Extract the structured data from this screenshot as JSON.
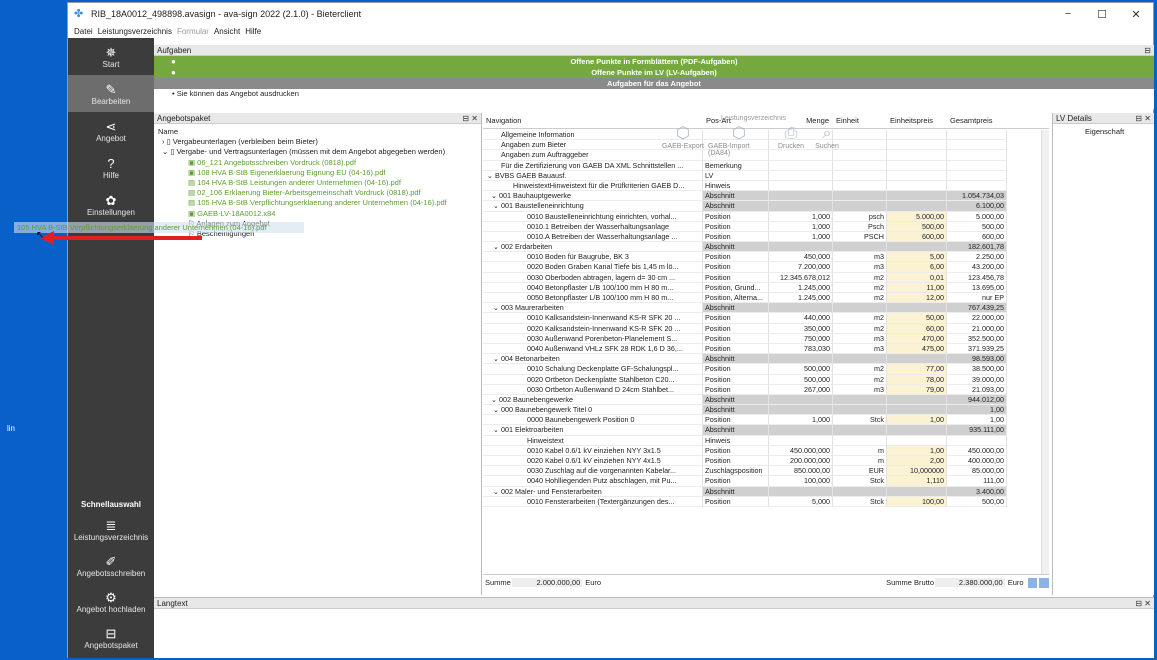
{
  "desktop": {
    "icon_label": "lin"
  },
  "window": {
    "title": "RIB_18A0012_498898.avasign - ava-sign 2022 (2.1.0) - Bieterclient",
    "controls": {
      "minimize": "−",
      "maximize": "☐",
      "close": "✕"
    }
  },
  "menu": {
    "items": [
      "Datei",
      "Leistungsverzeichnis",
      "Formular",
      "Ansicht",
      "Hilfe"
    ]
  },
  "sidebar": {
    "top": [
      {
        "label": "Start",
        "icon": "snowflake-icon",
        "glyph": "✵"
      },
      {
        "label": "Bearbeiten",
        "icon": "pencil-icon",
        "glyph": "✎"
      },
      {
        "label": "Angebot",
        "icon": "share-icon",
        "glyph": "⋖"
      },
      {
        "label": "Hilfe",
        "icon": "help-icon",
        "glyph": "?"
      },
      {
        "label": "Einstellungen",
        "icon": "gear-icon",
        "glyph": "✿"
      }
    ],
    "quick_header": "Schnellauswahl",
    "bottom": [
      {
        "label": "Leistungsverzeichnis",
        "icon": "coins-icon",
        "glyph": "≣"
      },
      {
        "label": "Angebotsschreiben",
        "icon": "edit-doc-icon",
        "glyph": "✐"
      },
      {
        "label": "Angebot hochladen",
        "icon": "upload-icon",
        "glyph": "⚙"
      },
      {
        "label": "Angebotspaket",
        "icon": "package-icon",
        "glyph": "⊟"
      }
    ]
  },
  "aufgaben": {
    "title": "Aufgaben",
    "bars": [
      "Offene Punkte in Formblättern (PDF-Aufgaben)",
      "Offene Punkte im LV (LV-Aufgaben)",
      "Aufgaben für das Angebot"
    ],
    "info": "Sie können das Angebot ausdrucken"
  },
  "angebotspaket": {
    "title": "Angebotspaket",
    "header": "Name",
    "items": [
      "Vergabeunterlagen (verbleiben beim Bieter)",
      "Vergabe- und Vertragsunterlagen (müssen mit dem Angebot abgegeben werden)",
      "06_121 Angebotsschreiben Vordruck (0818).pdf",
      "108 HVA B-StB Eigenerklaerung Eignung EU (04-16).pdf",
      "104 HVA B-StB Leistungen anderer Unternehmen (04-16).pdf",
      "02_106 Erklaerung Bieter-Arbeitsgemeinschaft Vordruck (0818).pdf",
      "105 HVA B-StB Verpflichtungserklaerung anderer Unternehmen (04-16).pdf",
      "GAEB-LV-18A0012.x84",
      "Anlagen zum Angebot",
      "Bescheinigungen"
    ],
    "drag_text": "105 HVA B-StB Verpflichtungserklaerung anderer Unternehmen (04-16).pdf"
  },
  "navigation": {
    "title": "Navigation",
    "columns": [
      "Pos-Art",
      "Menge",
      "Einheit",
      "Einheitspreis",
      "Gesamtpreis"
    ],
    "toolbar_group": "Leistungsverzeichnis",
    "toolbar": [
      "GAEB-Export",
      "GAEB-Import (DA84)",
      "Drucken",
      "Suchen"
    ],
    "rows": [
      [
        "Allgemeine Information",
        "",
        "",
        "",
        "",
        ""
      ],
      [
        "Angaben zum Bieter",
        "",
        "",
        "",
        "",
        ""
      ],
      [
        "Angaben zum Auftraggeber",
        "",
        "",
        "",
        "",
        ""
      ],
      [
        "Für die Zertifizierung von GAEB DA XML Schnittstellen ...",
        "Bemerkung",
        "",
        "",
        "",
        ""
      ],
      [
        "BVBS GAEB Bauausf.",
        "LV",
        "",
        "",
        "",
        ""
      ],
      [
        "HinweistextHinweistext für die Prüfkriterien GAEB D...",
        "Hinweis",
        "",
        "",
        "",
        ""
      ],
      [
        "001 Bauhauptgewerke",
        "Abschnitt",
        "",
        "",
        "",
        "1.054.734,03"
      ],
      [
        "001 Baustelleneinrichtung",
        "Abschnitt",
        "",
        "",
        "",
        "6.100,00"
      ],
      [
        "0010 Baustelleneinrichtung einrichten, vorhal...",
        "Position",
        "1,000",
        "psch",
        "5.000,00",
        "5.000,00"
      ],
      [
        "0010.1 Betreiben der Wasserhaltungsanlage",
        "Position",
        "1,000",
        "Psch",
        "500,00",
        "500,00"
      ],
      [
        "0010.A Betreiben der Wasserhaltungsanlage ...",
        "Position",
        "1,000",
        "PSCH",
        "600,00",
        "600,00"
      ],
      [
        "002 Erdarbeiten",
        "Abschnitt",
        "",
        "",
        "",
        "182.601,78"
      ],
      [
        "0010 Boden für Baugrube, BK 3",
        "Position",
        "450,000",
        "m3",
        "5,00",
        "2.250,00"
      ],
      [
        "0020 Boden Graben Kanal Tiefe bis 1,45 m lö...",
        "Position",
        "7.200,000",
        "m3",
        "6,00",
        "43.200,00"
      ],
      [
        "0030 Oberboden abtragen, lagern d= 30 cm ...",
        "Position",
        "12.345.678,012",
        "m2",
        "0,01",
        "123.456,78"
      ],
      [
        "0040 Betonpflaster L/B 100/100 mm H 80 m...",
        "Position, Grund...",
        "1.245,000",
        "m2",
        "11,00",
        "13.695,00"
      ],
      [
        "0050 Betonpflaster L/B 100/100 mm H 80 m...",
        "Position, Alterna...",
        "1.245,000",
        "m2",
        "12,00",
        "nur EP"
      ],
      [
        "003 Maurerarbeiten",
        "Abschnitt",
        "",
        "",
        "",
        "767.439,25"
      ],
      [
        "0010 Kalksandstein-Innenwand KS-R SFK 20 ...",
        "Position",
        "440,000",
        "m2",
        "50,00",
        "22.000,00"
      ],
      [
        "0020 Kalksandstein-Innenwand KS-R SFK 20 ...",
        "Position",
        "350,000",
        "m2",
        "60,00",
        "21.000,00"
      ],
      [
        "0030 Außenwand Porenbeton-Planelement S...",
        "Position",
        "750,000",
        "m3",
        "470,00",
        "352.500,00"
      ],
      [
        "0040 Außenwand VHLz SFK 28 RDK 1,6 D 36,...",
        "Position",
        "783,030",
        "m3",
        "475,00",
        "371.939,25"
      ],
      [
        "004 Betonarbeiten",
        "Abschnitt",
        "",
        "",
        "",
        "98.593,00"
      ],
      [
        "0010 Schalung Deckenplatte GF-Schalungspl...",
        "Position",
        "500,000",
        "m2",
        "77,00",
        "38.500,00"
      ],
      [
        "0020 Ortbeton Deckenplatte Stahlbeton C20...",
        "Position",
        "500,000",
        "m2",
        "78,00",
        "39.000,00"
      ],
      [
        "0030 Ortbeton Außenwand D 24cm Stahlbet...",
        "Position",
        "267,000",
        "m3",
        "79,00",
        "21.093,00"
      ],
      [
        "002 Baunebengewerke",
        "Abschnitt",
        "",
        "",
        "",
        "944.012,00"
      ],
      [
        "000 Baunebengewerk Titel 0",
        "Abschnitt",
        "",
        "",
        "",
        "1,00"
      ],
      [
        "0000 Baunebengewerk Position 0",
        "Position",
        "1,000",
        "Stck",
        "1,00",
        "1,00"
      ],
      [
        "001 Elektroarbeiten",
        "Abschnitt",
        "",
        "",
        "",
        "935.111,00"
      ],
      [
        "Hinweistext",
        "Hinweis",
        "",
        "",
        "",
        ""
      ],
      [
        "0010 Kabel 0.6/1 kV einziehen NYY 3x1.5",
        "Position",
        "450.000,000",
        "m",
        "1,00",
        "450.000,00"
      ],
      [
        "0020 Kabel 0.6/1 kV einziehen NYY 4x1.5",
        "Position",
        "200.000,000",
        "m",
        "2,00",
        "400.000,00"
      ],
      [
        "0030 Zuschlag auf die vorgenannten Kabelar...",
        "Zuschlagsposition",
        "850.000,00",
        "EUR",
        "10,000000",
        "85.000,00"
      ],
      [
        "0040 Hohlliegenden Putz abschlagen, mit Pu...",
        "Position",
        "100,000",
        "Stck",
        "1,110",
        "111,00"
      ],
      [
        "002 Maler- und Fensterarbeiten",
        "Abschnitt",
        "",
        "",
        "",
        "3.400,00"
      ],
      [
        "0010 Fensterarbeiten (Textergänzungen des...",
        "Position",
        "5,000",
        "Stck",
        "100,00",
        "500,00"
      ]
    ],
    "summe_label": "Summe",
    "summe_value": "2.000.000,00",
    "currency": "Euro",
    "brutto_label": "Summe Brutto",
    "brutto_value": "2.380.000,00"
  },
  "lvdetails": {
    "title": "LV Details",
    "header": "Eigenschaft"
  },
  "langtext": {
    "title": "Langtext"
  }
}
